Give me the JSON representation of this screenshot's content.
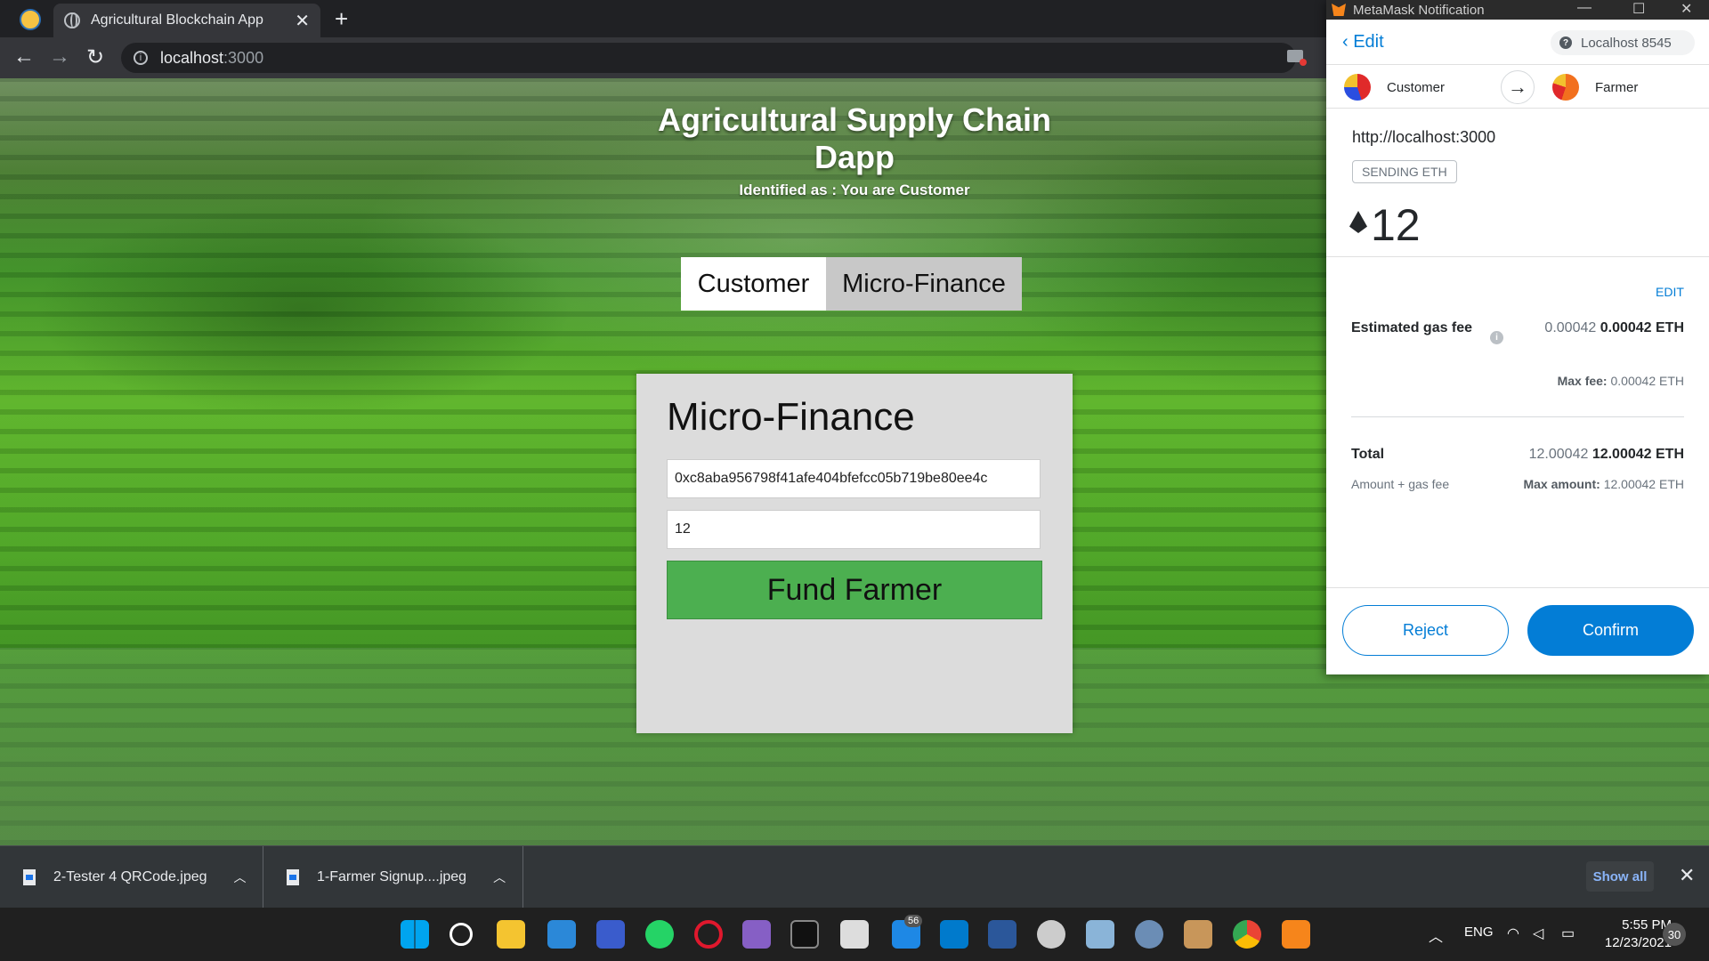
{
  "browser": {
    "tab_title": "Agricultural Blockchain App",
    "tab_close": "✕",
    "new_tab": "+",
    "url_host": "localhost",
    "url_port": ":3000"
  },
  "page": {
    "title": "Agricultural Supply Chain Dapp",
    "identified": "Identified as : You are Customer",
    "tab_customer": "Customer",
    "tab_micro": "Micro-Finance",
    "card_title": "Micro-Finance",
    "address_value": "0xc8aba956798f41afe404bfefcc05b719be80ee4c",
    "amount_value": "12",
    "fund_button": "Fund Farmer"
  },
  "downloads": {
    "items": [
      {
        "name": "2-Tester 4 QRCode.jpeg"
      },
      {
        "name": "1-Farmer Signup....jpeg"
      }
    ],
    "show_all": "Show all",
    "close": "✕"
  },
  "taskbar": {
    "lang": "ENG",
    "time": "5:55 PM",
    "date": "12/23/2021",
    "badge_count": "56",
    "notifications": "30"
  },
  "metamask": {
    "window_title": "MetaMask Notification",
    "edit": "Edit",
    "network": "Localhost 8545",
    "from_account": "Customer",
    "to_account": "Farmer",
    "origin": "http://localhost:3000",
    "action": "SENDING ETH",
    "amount": "12",
    "edit_link": "EDIT",
    "gas_label": "Estimated gas fee",
    "gas_secondary": "0.00042",
    "gas_primary": "0.00042 ETH",
    "max_fee_label": "Max fee:",
    "max_fee_value": "0.00042 ETH",
    "total_label": "Total",
    "total_secondary": "12.00042",
    "total_primary": "12.00042 ETH",
    "total_sub": "Amount + gas fee",
    "max_amount_label": "Max amount:",
    "max_amount_value": "12.00042 ETH",
    "reject": "Reject",
    "confirm": "Confirm",
    "accent_color": "#037dd6"
  }
}
